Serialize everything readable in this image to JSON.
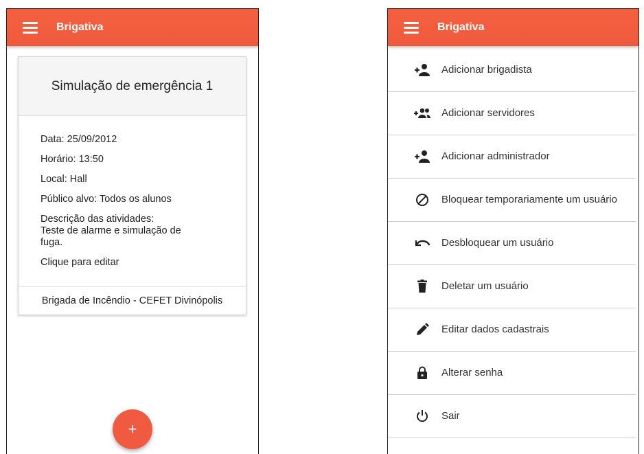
{
  "left_screen": {
    "app_title": "Brigativa",
    "card": {
      "title": "Simulação de emergência 1",
      "lines": [
        "Data: 25/09/2012",
        "Horário: 13:50",
        "Local: Hall",
        "Público alvo: Todos os alunos",
        "Descrição das atividades:\nTeste de alarme e simulação de\nfuga.",
        "Clique para editar"
      ],
      "footer": "Brigada de Incêndio - CEFET Divinópolis"
    },
    "fab_label": "+"
  },
  "right_screen": {
    "app_title": "Brigativa",
    "menu": [
      {
        "icon": "person-add-icon",
        "label": "Adicionar brigadista"
      },
      {
        "icon": "group-add-icon",
        "label": "Adicionar servidores"
      },
      {
        "icon": "person-add-icon",
        "label": "Adicionar administrador"
      },
      {
        "icon": "block-icon",
        "label": "Bloquear temporariamente um usuário"
      },
      {
        "icon": "undo-icon",
        "label": "Desbloquear um usuário"
      },
      {
        "icon": "delete-icon",
        "label": "Deletar um usuário"
      },
      {
        "icon": "edit-icon",
        "label": "Editar dados cadastrais"
      },
      {
        "icon": "lock-icon",
        "label": "Alterar senha"
      },
      {
        "icon": "power-icon",
        "label": "Sair"
      }
    ]
  },
  "colors": {
    "app_bar": "#f05a40",
    "fab": "#f05a40",
    "card_header_bg": "#f5f5f5",
    "divider": "#cfcfcf"
  }
}
